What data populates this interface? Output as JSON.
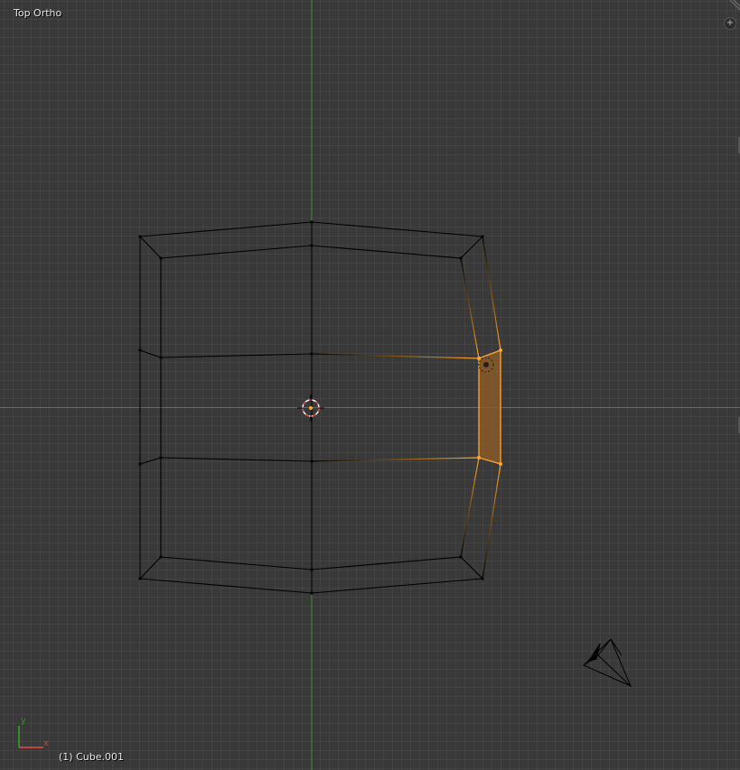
{
  "viewport": {
    "view_name": "Top Ortho",
    "active_object": "(1) Cube.001",
    "axis_labels": {
      "x": "x",
      "y": "y"
    },
    "add_button_glyph": "+"
  },
  "colors": {
    "background": "#393939",
    "x_axis": "#c0453f",
    "y_axis": "#3a8a2a",
    "wire": "#000000",
    "selection": "#ffa52b",
    "selected_face": "#8a5a28"
  },
  "icons": {
    "cursor": "3d-cursor-icon",
    "camera": "camera-icon",
    "lamp": "lamp-icon",
    "axis_gizmo": "axis-gizmo-icon"
  }
}
